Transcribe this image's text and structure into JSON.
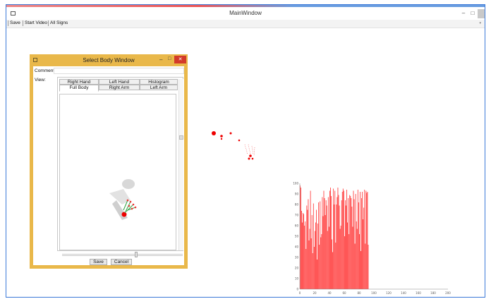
{
  "window": {
    "title": "MainWindow",
    "min_label": "–",
    "max_label": "□",
    "close_label": "✕"
  },
  "menu": {
    "items": [
      "Save",
      "Start Video",
      "All Signs"
    ]
  },
  "dialog": {
    "title": "Select Body Window",
    "min_label": "–",
    "max_label": "□",
    "close_label": "✕",
    "comment_label": "Comment:",
    "comment_value": "",
    "view_label": "View:",
    "tabs_row1": [
      "Right Hand",
      "Left Hand",
      "Histogram"
    ],
    "tabs_row2": [
      "Full Body",
      "Right Arm",
      "Left Arm"
    ],
    "selected_tab": "Full Body",
    "save_label": "Save",
    "cancel_label": "Cancel"
  },
  "colors": {
    "accent_blue": "#3a78d8",
    "dialog_frame": "#e9b84a",
    "close_red": "#d33a2a",
    "chart_red": "#ff2a2a",
    "skeleton_green": "#3aa64a"
  },
  "chart_data": {
    "type": "bar",
    "title": "",
    "xlabel": "",
    "ylabel": "",
    "xlim": [
      0,
      200
    ],
    "ylim": [
      0,
      100
    ],
    "xticks": [
      0,
      20,
      40,
      60,
      80,
      100,
      120,
      140,
      160,
      180,
      200
    ],
    "yticks": [
      0,
      10,
      20,
      30,
      40,
      50,
      60,
      70,
      80,
      90,
      100
    ],
    "x": [
      0,
      1,
      2,
      3,
      4,
      5,
      6,
      7,
      8,
      9,
      10,
      11,
      12,
      13,
      14,
      15,
      16,
      17,
      18,
      19,
      20,
      21,
      22,
      23,
      24,
      25,
      26,
      27,
      28,
      29,
      30,
      31,
      32,
      33,
      34,
      35,
      36,
      37,
      38,
      39,
      40,
      41,
      42,
      43,
      44,
      45,
      46,
      47,
      48,
      49,
      50,
      51,
      52,
      53,
      54,
      55,
      56,
      57,
      58,
      59,
      60,
      61,
      62,
      63,
      64,
      65,
      66,
      67,
      68,
      69,
      70,
      71,
      72,
      73,
      74,
      75,
      76,
      77,
      78,
      79,
      80,
      81,
      82,
      83,
      84,
      85,
      86,
      87,
      88,
      89,
      90,
      91,
      92
    ],
    "values": [
      98,
      96,
      74,
      63,
      72,
      71,
      60,
      64,
      38,
      79,
      75,
      85,
      46,
      57,
      93,
      48,
      70,
      34,
      81,
      40,
      55,
      63,
      75,
      28,
      62,
      82,
      42,
      83,
      49,
      52,
      87,
      69,
      93,
      86,
      70,
      84,
      79,
      55,
      87,
      59,
      93,
      96,
      88,
      47,
      35,
      95,
      80,
      93,
      44,
      80,
      87,
      96,
      89,
      79,
      57,
      60,
      84,
      92,
      95,
      93,
      50,
      84,
      79,
      94,
      63,
      86,
      52,
      89,
      88,
      86,
      78,
      59,
      93,
      85,
      43,
      90,
      64,
      57,
      94,
      82,
      52,
      92,
      36,
      86,
      92,
      66,
      77,
      94,
      43,
      93,
      91,
      92,
      42
    ]
  }
}
